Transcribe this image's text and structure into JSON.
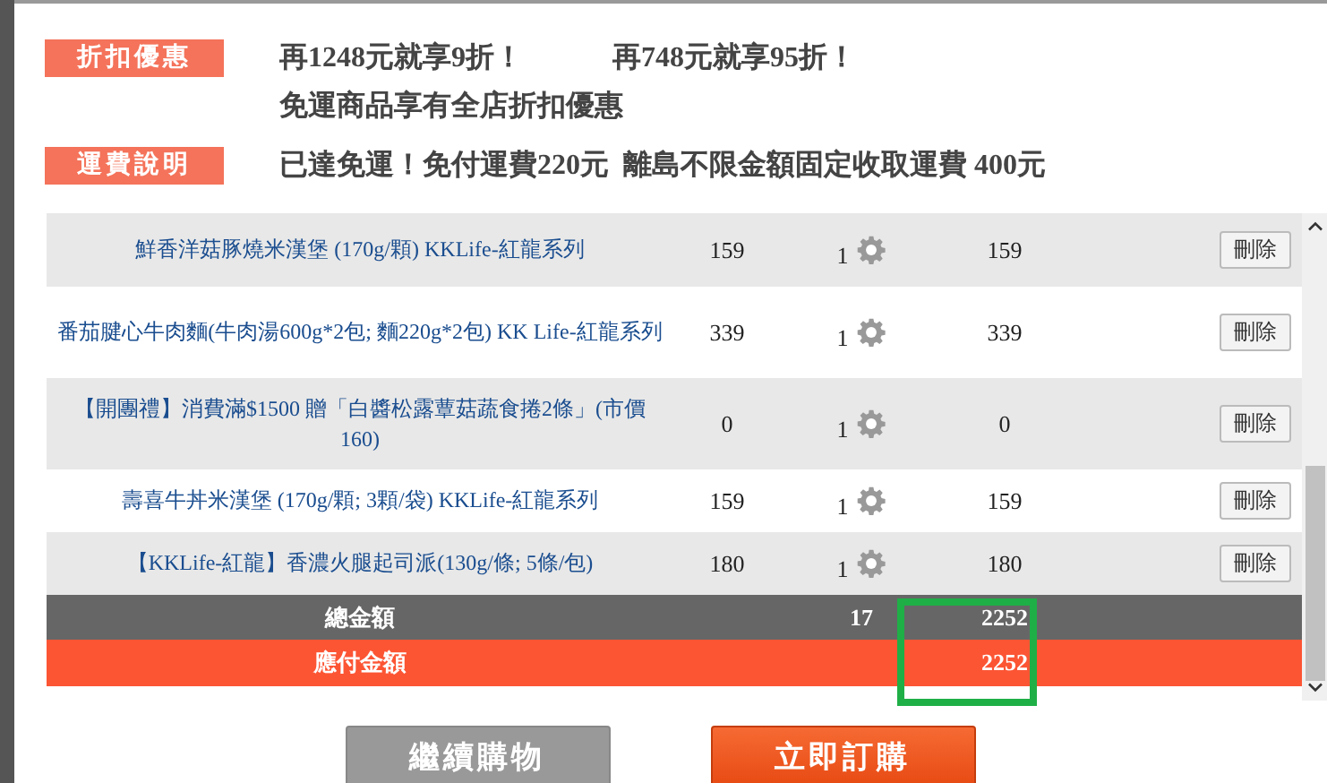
{
  "promotions": [
    {
      "tag": "折扣優惠",
      "lines": [
        "再1248元就享**9**折！",
        "再748元就享**95**折！"
      ],
      "note": "免運商品享有全店折扣優惠"
    },
    {
      "tag": "運費說明",
      "lines": [
        "已達免運！免付運費**220**元  離島不限金額固定收取運費 **400**元"
      ]
    }
  ],
  "cart": {
    "rows": [
      {
        "name": "鮮香洋菇豚燒米漢堡 (170g/顆) KKLife-紅龍系列",
        "price": "159",
        "qty": "1",
        "subtotal": "159",
        "delete": "刪除"
      },
      {
        "name": "番茄腱心牛肉麵(牛肉湯600g*2包; 麵220g*2包) KK Life-紅龍系列",
        "price": "339",
        "qty": "1",
        "subtotal": "339",
        "delete": "刪除"
      },
      {
        "name": "【開團禮】消費滿$1500 贈「白醬松露蕈菇蔬食捲2條」(市價160)",
        "price": "0",
        "qty": "1",
        "subtotal": "0",
        "delete": "刪除"
      },
      {
        "name": "壽喜牛丼米漢堡 (170g/顆; 3顆/袋) KKLife-紅龍系列",
        "price": "159",
        "qty": "1",
        "subtotal": "159",
        "delete": "刪除"
      },
      {
        "name": "【KKLife-紅龍】香濃火腿起司派(130g/條; 5條/包)",
        "price": "180",
        "qty": "1",
        "subtotal": "180",
        "delete": "刪除"
      }
    ],
    "total": {
      "label": "總金額",
      "qty": "17",
      "amount": "2252"
    },
    "payable": {
      "label": "應付金額",
      "amount": "2252"
    },
    "highlighted": true
  },
  "buttons": [
    {
      "label": "繼續購物",
      "kind": "secondary"
    },
    {
      "label": "立即訂購",
      "kind": "primary"
    }
  ]
}
